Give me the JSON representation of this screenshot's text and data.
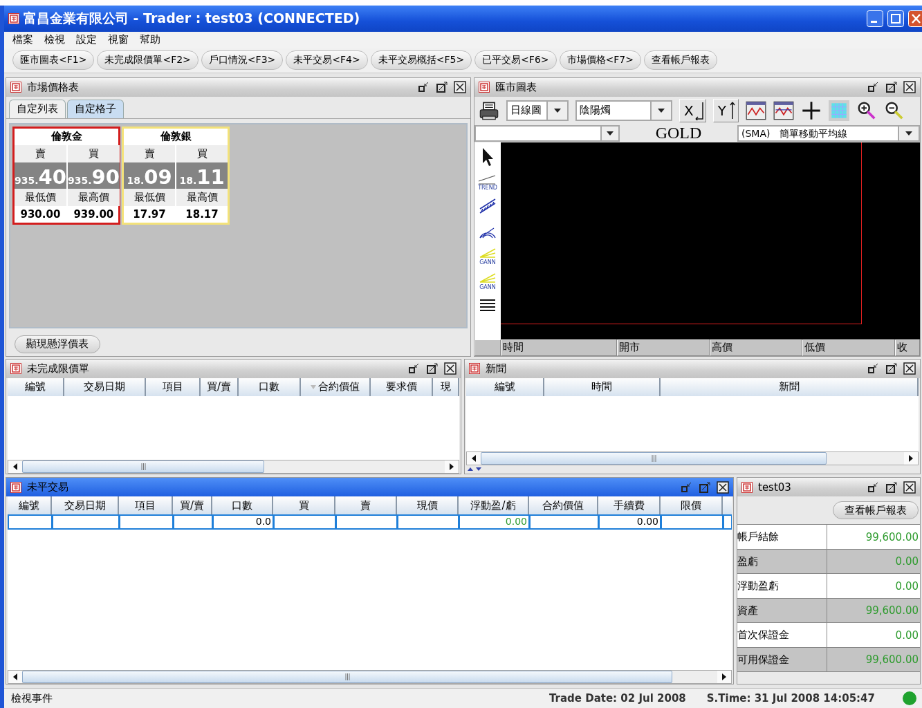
{
  "window": {
    "title": "富昌金業有限公司 - Trader : test03 (CONNECTED)"
  },
  "menu": [
    "檔案",
    "檢視",
    "設定",
    "視窗",
    "幫助"
  ],
  "toolbar": [
    "匯市圖表<F1>",
    "未完成限價單<F2>",
    "戶口情況<F3>",
    "未平交易<F4>",
    "未平交易概括<F5>",
    "已平交易<F6>",
    "市場價格<F7>",
    "查看帳戶報表"
  ],
  "market_panel": {
    "title": "市場價格表",
    "active": false,
    "tabs": [
      {
        "label": "自定列表",
        "selected": false
      },
      {
        "label": "自定格子",
        "selected": true
      }
    ],
    "cards": [
      {
        "name": "倫敦金",
        "selected": true,
        "sell_label": "賣",
        "buy_label": "買",
        "sell_prefix": "935.",
        "sell_big": "40",
        "buy_prefix": "935.",
        "buy_big": "90",
        "low_label": "最低價",
        "high_label": "最高價",
        "low": "930.00",
        "high": "939.00"
      },
      {
        "name": "倫敦銀",
        "selected": false,
        "sell_label": "賣",
        "buy_label": "買",
        "sell_prefix": "18.",
        "sell_big": "09",
        "buy_prefix": "18.",
        "buy_big": "11",
        "low_label": "最低價",
        "high_label": "最高價",
        "low": "17.97",
        "high": "18.17"
      }
    ],
    "button": "顯現懸浮價表"
  },
  "chart_panel": {
    "title": "匯市圖表",
    "active": false,
    "period": "日線圖",
    "style": "陰陽燭",
    "symbol": "GOLD",
    "axis_buttons": [
      "X",
      "Y"
    ],
    "indicator": "(SMA)　簡單移動平均線",
    "tools": [
      {
        "kind": "pointer"
      },
      {
        "kind": "trend",
        "label": "TREND"
      },
      {
        "kind": "channel"
      },
      {
        "kind": "arc"
      },
      {
        "kind": "fan",
        "label": "GANN"
      },
      {
        "kind": "fan",
        "label": "GANN"
      },
      {
        "kind": "lines"
      }
    ],
    "columns": [
      "時間",
      "開市",
      "高價",
      "低價",
      "收"
    ]
  },
  "orders_panel": {
    "title": "未完成限價單",
    "active": false,
    "columns": [
      "編號",
      "交易日期",
      "項目",
      "買/賣",
      "口數",
      "合約價值",
      "要求價",
      "現"
    ]
  },
  "news_panel": {
    "title": "新聞",
    "active": false,
    "columns": [
      "編號",
      "時間",
      "新聞"
    ]
  },
  "positions_panel": {
    "title": "未平交易",
    "active": true,
    "columns": [
      "編號",
      "交易日期",
      "項目",
      "買/賣",
      "口數",
      "買",
      "賣",
      "現價",
      "浮動盈/虧",
      "合約價值",
      "手續費",
      "限價"
    ],
    "cells": [
      {
        "kind": "empty"
      },
      {
        "kind": "empty"
      },
      {
        "kind": "empty"
      },
      {
        "kind": "empty"
      },
      {
        "kind": "plain",
        "value": "0.0"
      },
      {
        "kind": "empty"
      },
      {
        "kind": "empty"
      },
      {
        "kind": "empty"
      },
      {
        "kind": "profit",
        "value": "0.00"
      },
      {
        "kind": "empty"
      },
      {
        "kind": "plain",
        "value": "0.00"
      },
      {
        "kind": "empty"
      }
    ]
  },
  "account_panel": {
    "title": "test03",
    "active": false,
    "button": "查看帳戶報表",
    "rows": [
      {
        "label": "帳戶結餘",
        "value": "99,600.00"
      },
      {
        "label": "盈虧",
        "value": "0.00"
      },
      {
        "label": "浮動盈虧",
        "value": "0.00"
      },
      {
        "label": "資產",
        "value": "99,600.00"
      },
      {
        "label": "首次保證金",
        "value": "0.00"
      },
      {
        "label": "可用保證金",
        "value": "99,600.00"
      }
    ]
  },
  "status_bar": {
    "message": "檢視事件",
    "trade_date": "Trade Date: 02 Jul 2008",
    "server_time": "S.Time: 31 Jul 2008 14:05:47",
    "connected": true
  }
}
